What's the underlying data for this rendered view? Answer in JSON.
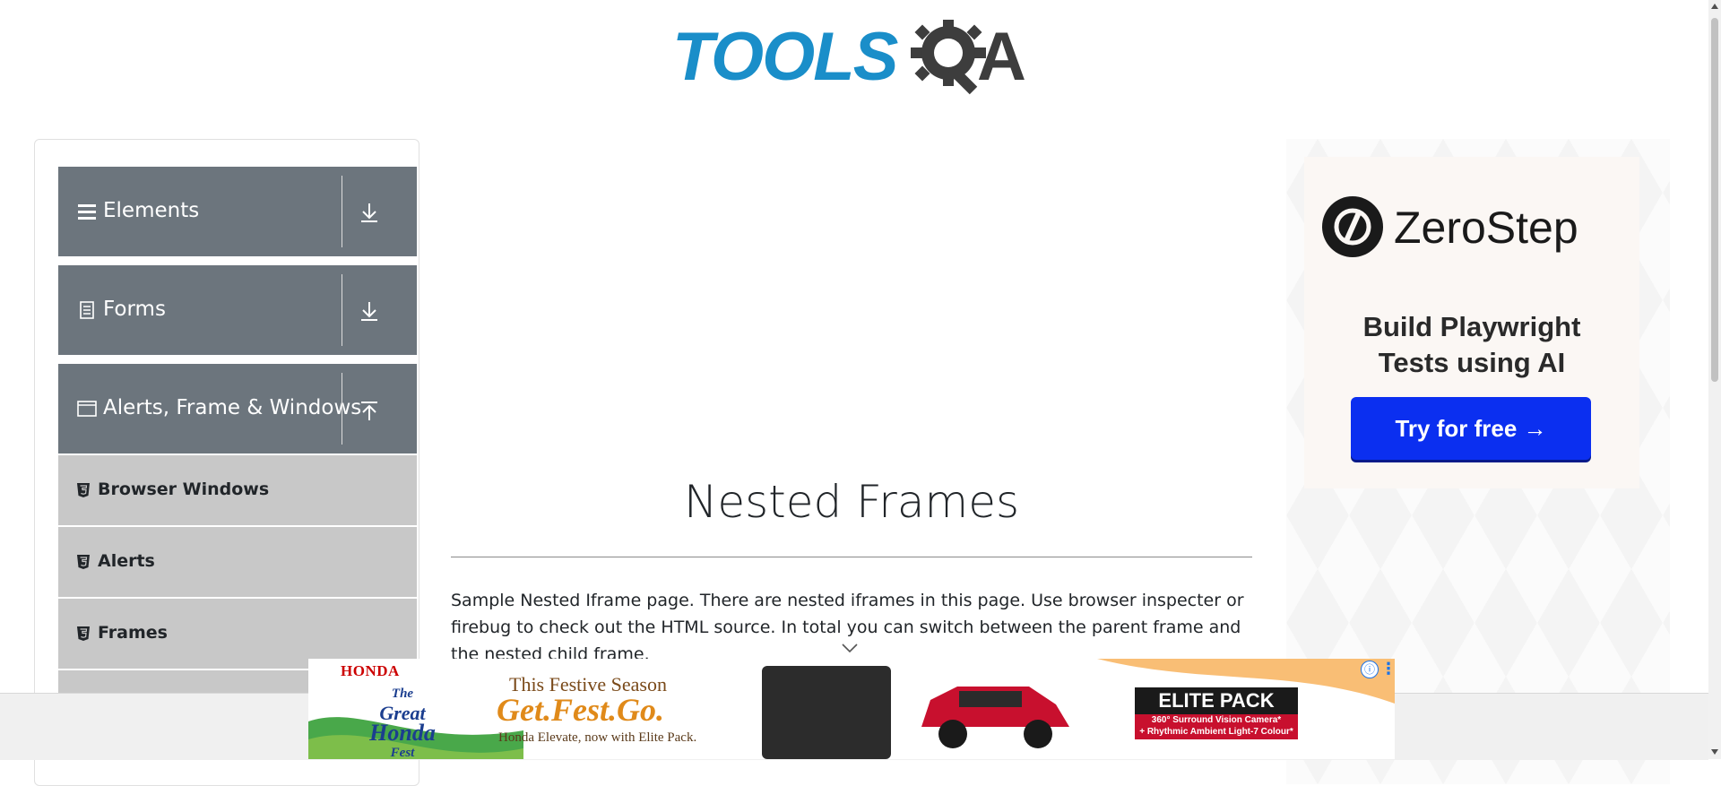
{
  "logo": {
    "brand_left": "TOOLS",
    "brand_right": "A"
  },
  "sidebar": {
    "groups": [
      {
        "label": "Elements",
        "icon": "hamburger-icon",
        "arrow": "download-arrow-icon"
      },
      {
        "label": "Forms",
        "icon": "document-icon",
        "arrow": "download-arrow-icon"
      },
      {
        "label": "Alerts, Frame & Windows",
        "icon": "window-icon",
        "arrow": "upload-arrow-icon"
      }
    ],
    "submenu": [
      {
        "label": "Browser Windows",
        "icon": "html5-shield-icon"
      },
      {
        "label": "Alerts",
        "icon": "html5-shield-icon"
      },
      {
        "label": "Frames",
        "icon": "html5-shield-icon"
      }
    ]
  },
  "main": {
    "title": "Nested Frames",
    "description": "Sample Nested Iframe page. There are nested iframes in this page. Use browser inspecter or firebug to check out the HTML source. In total you can switch between the parent frame and the nested child frame."
  },
  "right_ad": {
    "brand": "ZeroStep",
    "tagline_line1": "Build Playwright",
    "tagline_line2": "Tests using AI",
    "cta": "Try for free →",
    "cta_color": "#0b2ff0"
  },
  "bottom_ad": {
    "brand": "HONDA",
    "fest_line1": "The",
    "fest_line2": "Great",
    "fest_line3": "Honda",
    "fest_line4": "Fest",
    "season": "This Festive Season",
    "slogan": "Get.Fest.Go.",
    "subline": "Honda Elevate, now with Elite Pack.",
    "elite_title": "ELITE PACK",
    "elite_sub1": "360° Surround Vision Camera*",
    "elite_sub2": "+ Rhythmic Ambient Light-7 Colour*",
    "info_glyph": "ⓘ",
    "menu_glyph": "⋮"
  },
  "colors": {
    "logo_blue": "#1a8ec9",
    "logo_dark": "#3d3d3d",
    "sidebar_header": "#6c757d",
    "submenu_bg": "#c8c8c8"
  }
}
